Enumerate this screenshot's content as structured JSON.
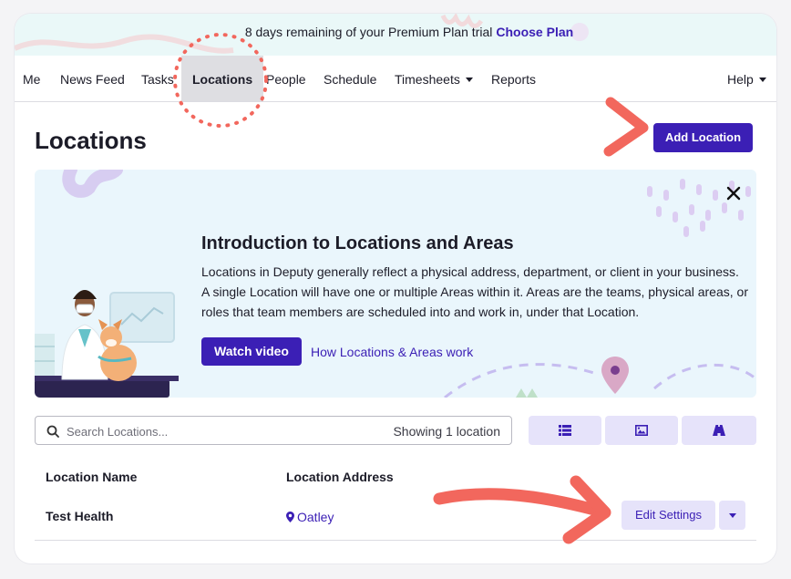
{
  "trial_banner": {
    "message": "8 days remaining of your Premium Plan trial",
    "cta": "Choose Plan"
  },
  "nav": {
    "items": [
      {
        "label": "Me"
      },
      {
        "label": "News Feed"
      },
      {
        "label": "Tasks"
      },
      {
        "label": "Locations",
        "active": true
      },
      {
        "label": "People"
      },
      {
        "label": "Schedule"
      },
      {
        "label": "Timesheets",
        "dropdown": true
      },
      {
        "label": "Reports"
      }
    ],
    "help": {
      "label": "Help",
      "dropdown": true
    }
  },
  "page": {
    "title": "Locations",
    "add_button": "Add Location"
  },
  "intro": {
    "title": "Introduction to Locations and Areas",
    "body": "Locations in Deputy generally reflect a physical address, department, or client in your business. A single Location will have one or multiple Areas within it. Areas are the teams, physical areas, or roles that team members are scheduled into and work in, under that Location.",
    "watch_button": "Watch video",
    "link": "How Locations & Areas work",
    "close_icon": "close-icon"
  },
  "search": {
    "placeholder": "Search Locations...",
    "value": "",
    "count_text": "Showing 1 location",
    "icon": "search-icon"
  },
  "view_toggles": [
    {
      "icon": "list-icon",
      "selected": true
    },
    {
      "icon": "image-icon",
      "selected": false
    },
    {
      "icon": "road-map-icon",
      "selected": false
    }
  ],
  "table": {
    "columns": [
      "Location Name",
      "Location Address"
    ],
    "rows": [
      {
        "name": "Test Health",
        "address": "Oatley",
        "address_icon": "map-marker-icon",
        "action": "Edit Settings"
      }
    ]
  },
  "colors": {
    "brand": "#3b1fb5",
    "annotation": "#f2675d",
    "secondary_button_bg": "#e6e3fa",
    "intro_bg": "#eaf6fc",
    "banner_bg": "#eaf8f8"
  }
}
